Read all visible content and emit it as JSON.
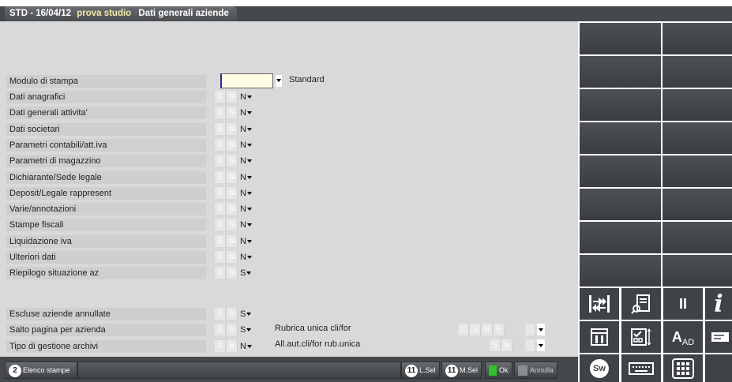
{
  "tab": {
    "part1": "STD - 16/04/12",
    "part2": "prova studio",
    "part3": "Dati generali aziende"
  },
  "form": {
    "modulo_label": "Modulo di stampa",
    "modulo_value": "",
    "modulo_option": "Standard",
    "sn_s": "S",
    "sn_n": "N",
    "rows": [
      {
        "label": "Dati anagrafici",
        "value": "N"
      },
      {
        "label": "Dati generali attivita'",
        "value": "N"
      },
      {
        "label": "Dati societari",
        "value": "N"
      },
      {
        "label": "Parametri contabili/att.iva",
        "value": "N"
      },
      {
        "label": "Parametri di magazzino",
        "value": "N"
      },
      {
        "label": "Dichiarante/Sede legale",
        "value": "N"
      },
      {
        "label": "Deposit/Legale rappresent",
        "value": "N"
      },
      {
        "label": "Varie/annotazioni",
        "value": "N"
      },
      {
        "label": "Stampe fiscali",
        "value": "N"
      },
      {
        "label": "Liquidazione iva",
        "value": "N"
      },
      {
        "label": "Ulteriori dati",
        "value": "N"
      },
      {
        "label": "Riepilogo situazione az",
        "value": "S"
      }
    ],
    "lower_rows": [
      {
        "label": "Escluse aziende annullate",
        "value": "S"
      },
      {
        "label": "Salto pagina per azienda",
        "value": "S"
      },
      {
        "label": "Tipo di gestione archivi",
        "value": "N"
      }
    ],
    "rubrica_label": "Rubrica unica cli/for",
    "rubrica_opts": [
      "C",
      "S",
      "N",
      "R"
    ],
    "allaut_label": "All.aut.cli/for rub.unica",
    "allaut_opts": [
      "S",
      "N"
    ]
  },
  "bottom": {
    "elenco_num": "2",
    "elenco_label": "Elenco stampe",
    "lsel_num": "11",
    "lsel_label": "L.Sel",
    "msel_num": "11",
    "msel_label": "M.Sel",
    "ok_label": "Ok",
    "annulla_label": "Annulla"
  },
  "right_icons": {
    "pause": "II",
    "info": "i",
    "ad_a": "A",
    "ad_sub": "AD",
    "sw": "Sw"
  },
  "colors": {
    "dark": "#45484c",
    "ok_green": "#2fbf2f",
    "input_bg": "#fffde4"
  }
}
